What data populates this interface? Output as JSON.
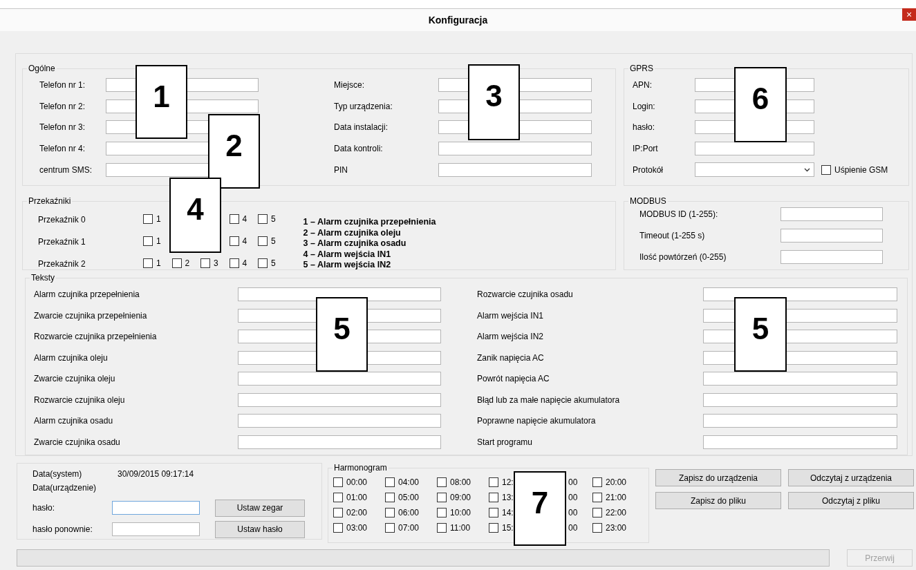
{
  "window": {
    "title": "Konfiguracja",
    "close_glyph": "×"
  },
  "general": {
    "title": "Ogólne",
    "phones": [
      {
        "label": "Telefon nr 1:"
      },
      {
        "label": "Telefon nr 2:"
      },
      {
        "label": "Telefon nr 3:"
      },
      {
        "label": "Telefon nr 4:"
      },
      {
        "label": "centrum SMS:"
      }
    ],
    "device": [
      {
        "label": "Miejsce:"
      },
      {
        "label": "Typ urządzenia:"
      },
      {
        "label": "Data instalacji:"
      },
      {
        "label": "Data kontroli:"
      },
      {
        "label": "PIN"
      }
    ]
  },
  "gprs": {
    "title": "GPRS",
    "fields": [
      {
        "label": "APN:"
      },
      {
        "label": "Login:"
      },
      {
        "label": "hasło:"
      },
      {
        "label": "IP:Port"
      }
    ],
    "protocol": {
      "label": "Protokół"
    },
    "gsm_sleep": {
      "label": "Uśpienie GSM",
      "checked": false
    }
  },
  "relays": {
    "title": "Przekaźniki",
    "rows": [
      {
        "label": "Przekaźnik 0",
        "channels": [
          {
            "kind": "box",
            "label": "1",
            "checked": false
          },
          {
            "kind": "covered"
          },
          {
            "kind": "covered"
          },
          {
            "kind": "box",
            "label": "4",
            "checked": false
          },
          {
            "kind": "box",
            "label": "5",
            "checked": false
          }
        ]
      },
      {
        "label": "Przekaźnik 1",
        "channels": [
          {
            "kind": "box",
            "label": "1",
            "checked": false
          },
          {
            "kind": "covered"
          },
          {
            "kind": "covered"
          },
          {
            "kind": "box",
            "label": "4",
            "checked": false
          },
          {
            "kind": "box",
            "label": "5",
            "checked": false
          }
        ]
      },
      {
        "label": "Przekaźnik 2",
        "channels": [
          {
            "kind": "box",
            "label": "1",
            "checked": false
          },
          {
            "kind": "box",
            "label": "2",
            "checked": false
          },
          {
            "kind": "box",
            "label": "3",
            "checked": false
          },
          {
            "kind": "box",
            "label": "4",
            "checked": false
          },
          {
            "kind": "box",
            "label": "5",
            "checked": false
          }
        ]
      }
    ],
    "legend": [
      "1 – Alarm czujnika przepełnienia",
      "2 – Alarm czujnika oleju",
      "3 – Alarm czujnika osadu",
      "4 – Alarm wejścia IN1",
      "5 – Alarm wejścia IN2"
    ]
  },
  "modbus": {
    "title": "MODBUS",
    "fields": [
      {
        "label": "MODBUS ID (1-255):"
      },
      {
        "label": "Timeout (1-255 s)"
      },
      {
        "label": "Ilość powtórzeń (0-255)"
      }
    ]
  },
  "texts": {
    "title": "Teksty",
    "left": [
      {
        "label": "Alarm czujnika przepełnienia"
      },
      {
        "label": "Zwarcie czujnika przepełnienia"
      },
      {
        "label": "Rozwarcie czujnika przepełnienia"
      },
      {
        "label": "Alarm czujnika oleju"
      },
      {
        "label": "Zwarcie czujnika oleju"
      },
      {
        "label": "Rozwarcie czujnika oleju"
      },
      {
        "label": "Alarm czujnika osadu"
      },
      {
        "label": "Zwarcie czujnika osadu"
      }
    ],
    "right": [
      {
        "label": "Rozwarcie czujnika osadu"
      },
      {
        "label": "Alarm wejścia IN1"
      },
      {
        "label": "Alarm wejścia IN2"
      },
      {
        "label": "Zanik napięcia AC"
      },
      {
        "label": "Powrót napięcia AC"
      },
      {
        "label": "Błąd lub za małe napięcie akumulatora"
      },
      {
        "label": "Poprawne napięcie akumulatora"
      },
      {
        "label": "Start programu"
      }
    ]
  },
  "clock": {
    "system_label": "Data(system)",
    "system_value": "30/09/2015 09:17:14",
    "device_label": "Data(urządzenie)",
    "password": {
      "label": "hasło:",
      "focused": true
    },
    "password_repeat": {
      "label": "hasło ponownie:",
      "focused": false
    },
    "buttons": [
      "Ustaw zegar",
      "Ustaw hasło"
    ]
  },
  "schedule": {
    "title": "Harmonogram",
    "slots": [
      {
        "kind": "box",
        "label": "00:00",
        "checked": false
      },
      {
        "kind": "box",
        "label": "01:00",
        "checked": false
      },
      {
        "kind": "box",
        "label": "02:00",
        "checked": false
      },
      {
        "kind": "box",
        "label": "03:00",
        "checked": false
      },
      {
        "kind": "box",
        "label": "04:00",
        "checked": false
      },
      {
        "kind": "box",
        "label": "05:00",
        "checked": false
      },
      {
        "kind": "box",
        "label": "06:00",
        "checked": false
      },
      {
        "kind": "box",
        "label": "07:00",
        "checked": false
      },
      {
        "kind": "box",
        "label": "08:00",
        "checked": false
      },
      {
        "kind": "box",
        "label": "09:00",
        "checked": false
      },
      {
        "kind": "box",
        "label": "10:00",
        "checked": false
      },
      {
        "kind": "box",
        "label": "11:00",
        "checked": false
      },
      {
        "kind": "box",
        "label": "12:",
        "checked": false
      },
      {
        "kind": "box",
        "label": "13:",
        "checked": false
      },
      {
        "kind": "box",
        "label": "14:",
        "checked": false
      },
      {
        "kind": "box",
        "label": "15:",
        "checked": false
      },
      {
        "kind": "covered",
        "label": "00"
      },
      {
        "kind": "covered",
        "label": "00"
      },
      {
        "kind": "covered",
        "label": "00"
      },
      {
        "kind": "covered",
        "label": "00"
      },
      {
        "kind": "box",
        "label": "20:00",
        "checked": false
      },
      {
        "kind": "box",
        "label": "21:00",
        "checked": false
      },
      {
        "kind": "box",
        "label": "22:00",
        "checked": false
      },
      {
        "kind": "box",
        "label": "23:00",
        "checked": false
      }
    ]
  },
  "actions": [
    "Zapisz do urządzenia",
    "Odczytaj z urządzenia",
    "Zapisz do pliku",
    "Odczytaj z pliku"
  ],
  "progress": {
    "level": 0
  },
  "stop_button": {
    "label": "Przerwij",
    "disabled": true
  },
  "callouts": [
    {
      "label": "1"
    },
    {
      "label": "3"
    },
    {
      "label": "6"
    },
    {
      "label": "2"
    },
    {
      "label": "4"
    },
    {
      "label": "5"
    },
    {
      "label": "5"
    },
    {
      "label": "7"
    }
  ]
}
